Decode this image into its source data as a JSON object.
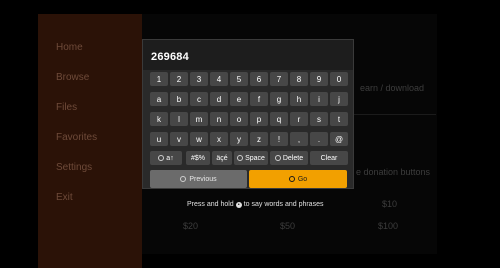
{
  "background": {
    "sidebar_items": [
      "Home",
      "Browse",
      "Files",
      "Favorites",
      "Settings",
      "Exit"
    ],
    "texts": [
      "earn / download",
      "e donation buttons",
      "$10",
      "$20",
      "$50",
      "$100"
    ]
  },
  "keyboard": {
    "input_value": "269684",
    "rows": [
      [
        "1",
        "2",
        "3",
        "4",
        "5",
        "6",
        "7",
        "8",
        "9",
        "0"
      ],
      [
        "a",
        "b",
        "c",
        "d",
        "e",
        "f",
        "g",
        "h",
        "i",
        "j"
      ],
      [
        "k",
        "l",
        "m",
        "n",
        "o",
        "p",
        "q",
        "r",
        "s",
        "t"
      ],
      [
        "u",
        "v",
        "w",
        "x",
        "y",
        "z",
        "!",
        ",",
        ".",
        "@"
      ]
    ],
    "function_keys": {
      "shift": "a↑",
      "symbols": "#$%",
      "accents": "äçé",
      "space": "Space",
      "delete": "Delete",
      "clear": "Clear"
    },
    "previous_label": "Previous",
    "go_label": "Go",
    "hint": "Press and hold",
    "hint_tail": "to say words and phrases"
  },
  "colors": {
    "go_accent": "#f2a000",
    "sidebar_bg": "#2b1207"
  }
}
